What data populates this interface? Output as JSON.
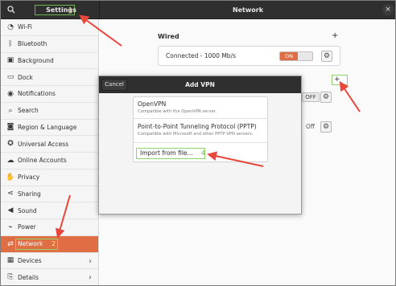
{
  "header": {
    "settings_title": "Settings",
    "settings_step": "1",
    "network_title": "Network",
    "search_icon": "search-icon",
    "close_icon": "close-icon",
    "close_glyph": "×"
  },
  "sidebar": {
    "items": [
      {
        "label": "Wi-Fi",
        "icon": "wifi-icon",
        "glyph": "◔"
      },
      {
        "label": "Bluetooth",
        "icon": "bluetooth-icon",
        "glyph": "ᛒ"
      },
      {
        "label": "Background",
        "icon": "background-icon",
        "glyph": "▣"
      },
      {
        "label": "Dock",
        "icon": "dock-icon",
        "glyph": "▭"
      },
      {
        "label": "Notifications",
        "icon": "bell-icon",
        "glyph": "◉"
      },
      {
        "label": "Search",
        "icon": "search-icon",
        "glyph": "⌕"
      },
      {
        "label": "Region & Language",
        "icon": "camera-icon",
        "glyph": "◙"
      },
      {
        "label": "Universal Access",
        "icon": "accessibility-icon",
        "glyph": "✪"
      },
      {
        "label": "Online Accounts",
        "icon": "cloud-icon",
        "glyph": "☁"
      },
      {
        "label": "Privacy",
        "icon": "hand-icon",
        "glyph": "✋"
      },
      {
        "label": "Sharing",
        "icon": "share-icon",
        "glyph": "⋖"
      },
      {
        "label": "Sound",
        "icon": "speaker-icon",
        "glyph": "◀"
      },
      {
        "label": "Power",
        "icon": "power-icon",
        "glyph": "⌁"
      },
      {
        "label": "Network",
        "icon": "network-icon",
        "glyph": "⇄",
        "active": true,
        "step": "2"
      },
      {
        "label": "Devices",
        "icon": "devices-icon",
        "glyph": "▦",
        "chevron": "›"
      },
      {
        "label": "Details",
        "icon": "details-icon",
        "glyph": "⎘",
        "chevron": "›"
      }
    ]
  },
  "main": {
    "wired_title": "Wired",
    "wired_plus": "+",
    "wired_status": "Connected - 1000 Mb/s",
    "wired_toggle": "ON",
    "vpn_plus": "+",
    "off_label_1": "OFF",
    "off_label_2": "Off",
    "gear_glyph": "⚙"
  },
  "dialog": {
    "title": "Add VPN",
    "cancel_label": "Cancel",
    "options": [
      {
        "title": "OpenVPN",
        "desc": "Compatible with the OpenVPN server."
      },
      {
        "title": "Point-to-Point Tunneling Protocol (PPTP)",
        "desc": "Compatible with Microsoft and other PPTP VPN servers."
      }
    ],
    "import_label": "Import from file...",
    "import_step": "4"
  },
  "colors": {
    "accent": "#e06e44",
    "annotation_box": "#8fd468",
    "arrow": "#e8473c",
    "headerbar": "#2f2f2f"
  }
}
